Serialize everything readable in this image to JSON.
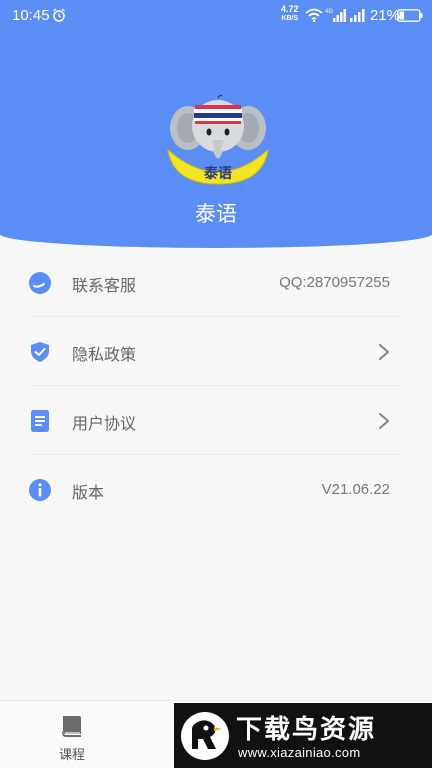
{
  "status_bar": {
    "time": "10:45",
    "net_speed_value": "4.72",
    "net_speed_unit": "KB/S",
    "network_type": "4G",
    "battery": "21%"
  },
  "header": {
    "app_name": "泰语",
    "logo_text": "泰语",
    "background_color": "#5b8ef5"
  },
  "menu": {
    "items": [
      {
        "icon": "customer-service-icon",
        "label": "联系客服",
        "value": "QQ:2870957255"
      },
      {
        "icon": "shield-icon",
        "label": "隐私政策"
      },
      {
        "icon": "document-icon",
        "label": "用户协议"
      },
      {
        "icon": "info-icon",
        "label": "版本",
        "value": "V21.06.22"
      }
    ]
  },
  "bottom_nav": {
    "tabs": [
      {
        "icon": "book-icon",
        "label": "课程"
      }
    ]
  },
  "watermark": {
    "title": "下载鸟资源",
    "url": "www.xiazainiao.com"
  }
}
